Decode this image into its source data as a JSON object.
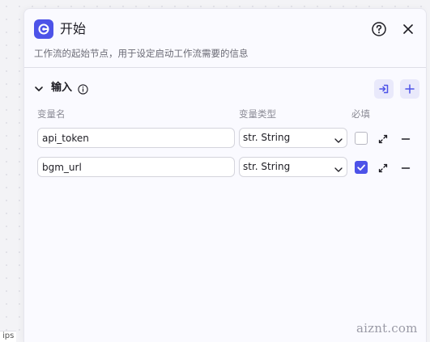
{
  "panel": {
    "title": "开始",
    "description": "工作流的起始节点，用于设定启动工作流需要的信息"
  },
  "inputs_section": {
    "title": "输入",
    "columns": {
      "name": "变量名",
      "type": "变量类型",
      "required": "必填"
    },
    "rows": [
      {
        "name": "api_token",
        "type": "str. String",
        "required": false
      },
      {
        "name": "bgm_url",
        "type": "str. String",
        "required": true
      }
    ]
  },
  "background": {
    "peek_label": "ips"
  },
  "watermark": "aiznt.com",
  "colors": {
    "accent": "#4d53e8",
    "panel_bg": "#fafaff",
    "button_bg": "#e9e9fb"
  },
  "icons": {
    "node": "start-node-icon",
    "help": "help-circle-icon",
    "close": "close-icon",
    "collapse": "chevron-down-icon",
    "info": "info-icon",
    "import": "import-icon",
    "add": "plus-icon",
    "expand": "expand-icon",
    "remove": "minus-icon"
  }
}
